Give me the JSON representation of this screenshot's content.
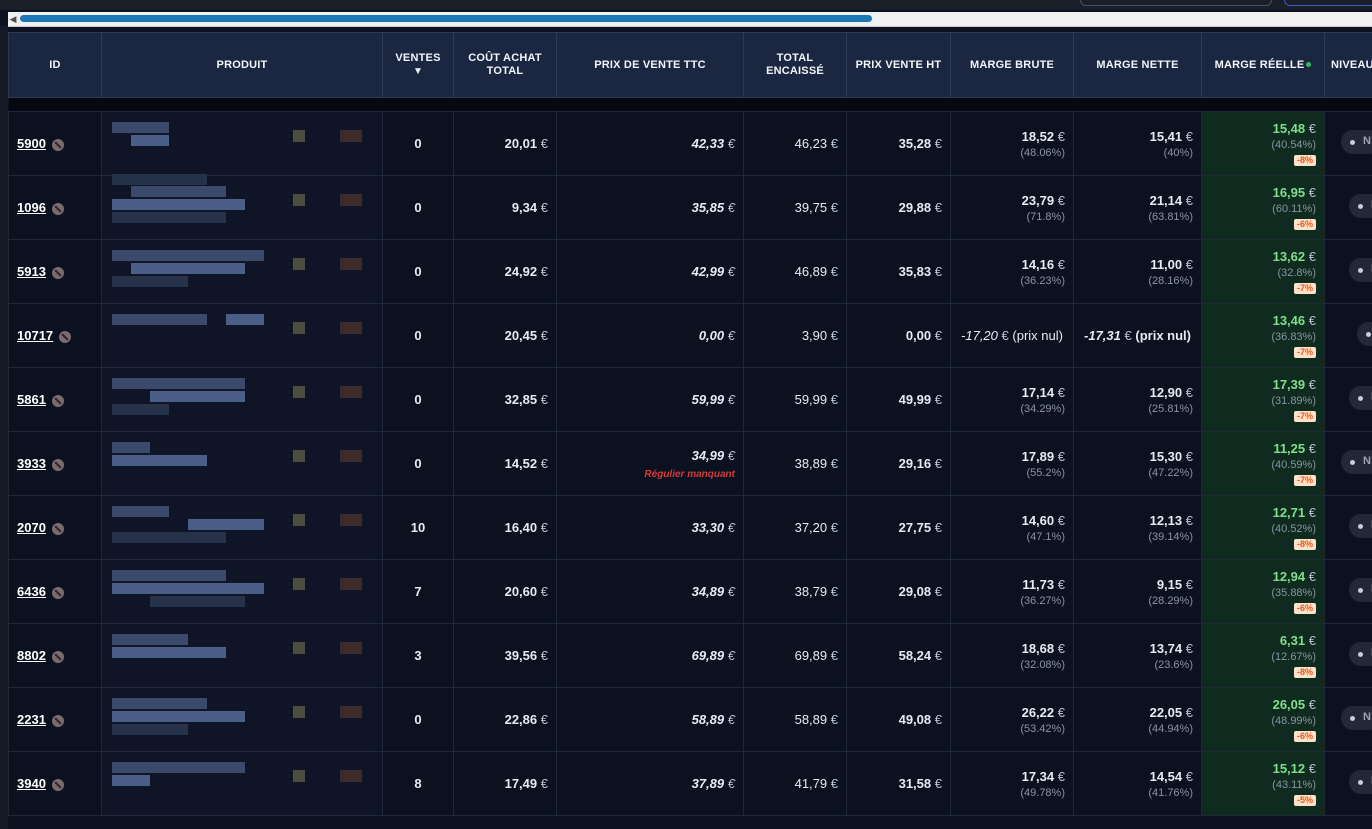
{
  "columns": {
    "id": "ID",
    "produit": "PRODUIT",
    "ventes": "VENTES",
    "ventes_sort": "▼",
    "cout": "COÛT ACHAT TOTAL",
    "ttc": "PRIX DE VENTE TTC",
    "encaisse": "TOTAL ENCAISSÉ",
    "ht": "PRIX VENTE HT",
    "marge_brute": "MARGE BRUTE",
    "marge_nette": "MARGE NETTE",
    "marge_reelle": "MARGE RÉELLE",
    "niveau": "NIVEAU"
  },
  "currency": "€",
  "rows": [
    {
      "id": "5900",
      "ventes": "0",
      "cout": "20,01",
      "ttc": "42,33",
      "encaisse": "46,23",
      "ht": "35,28",
      "mb": "18,52",
      "mb_pct": "(48.06%)",
      "mn": "15,41",
      "mn_pct": "(40%)",
      "mr": "15,48",
      "mr_pct": "(40.54%)",
      "mr_badge": "-8%"
    },
    {
      "id": "1096",
      "ventes": "0",
      "cout": "9,34",
      "ttc": "35,85",
      "encaisse": "39,75",
      "ht": "29,88",
      "mb": "23,79",
      "mb_pct": "(71.8%)",
      "mn": "21,14",
      "mn_pct": "(63.81%)",
      "mr": "16,95",
      "mr_pct": "(60.11%)",
      "mr_badge": "-6%"
    },
    {
      "id": "5913",
      "ventes": "0",
      "cout": "24,92",
      "ttc": "42,99",
      "encaisse": "46,89",
      "ht": "35,83",
      "mb": "14,16",
      "mb_pct": "(36.23%)",
      "mn": "11,00",
      "mn_pct": "(28.16%)",
      "mr": "13,62",
      "mr_pct": "(32.8%)",
      "mr_badge": "-7%"
    },
    {
      "id": "10717",
      "ventes": "0",
      "cout": "20,45",
      "ttc": "0,00",
      "encaisse": "3,90",
      "ht": "0,00",
      "mb": "-17,20",
      "mb_note": "(prix nul)",
      "mn": "-17,31",
      "mn_note": "(prix nul)",
      "mr": "13,46",
      "mr_pct": "(36.83%)",
      "mr_badge": "-7%"
    },
    {
      "id": "5861",
      "ventes": "0",
      "cout": "32,85",
      "ttc": "59,99",
      "encaisse": "59,99",
      "ht": "49,99",
      "mb": "17,14",
      "mb_pct": "(34.29%)",
      "mn": "12,90",
      "mn_pct": "(25.81%)",
      "mr": "17,39",
      "mr_pct": "(31.89%)",
      "mr_badge": "-7%"
    },
    {
      "id": "3933",
      "ventes": "0",
      "cout": "14,52",
      "ttc": "34,99",
      "ttc_warn": "Régulier manquant",
      "encaisse": "38,89",
      "ht": "29,16",
      "mb": "17,89",
      "mb_pct": "(55.2%)",
      "mn": "15,30",
      "mn_pct": "(47.22%)",
      "mr": "11,25",
      "mr_pct": "(40.59%)",
      "mr_badge": "-7%"
    },
    {
      "id": "2070",
      "ventes": "10",
      "cout": "16,40",
      "ttc": "33,30",
      "encaisse": "37,20",
      "ht": "27,75",
      "mb": "14,60",
      "mb_pct": "(47.1%)",
      "mn": "12,13",
      "mn_pct": "(39.14%)",
      "mr": "12,71",
      "mr_pct": "(40.52%)",
      "mr_badge": "-8%"
    },
    {
      "id": "6436",
      "ventes": "7",
      "cout": "20,60",
      "ttc": "34,89",
      "encaisse": "38,79",
      "ht": "29,08",
      "mb": "11,73",
      "mb_pct": "(36.27%)",
      "mn": "9,15",
      "mn_pct": "(28.29%)",
      "mr": "12,94",
      "mr_pct": "(35.88%)",
      "mr_badge": "-6%"
    },
    {
      "id": "8802",
      "ventes": "3",
      "cout": "39,56",
      "ttc": "69,89",
      "encaisse": "69,89",
      "ht": "58,24",
      "mb": "18,68",
      "mb_pct": "(32.08%)",
      "mn": "13,74",
      "mn_pct": "(23.6%)",
      "mr": "6,31",
      "mr_pct": "(12.67%)",
      "mr_badge": "-8%"
    },
    {
      "id": "2231",
      "ventes": "0",
      "cout": "22,86",
      "ttc": "58,89",
      "encaisse": "58,89",
      "ht": "49,08",
      "mb": "26,22",
      "mb_pct": "(53.42%)",
      "mn": "22,05",
      "mn_pct": "(44.94%)",
      "mr": "26,05",
      "mr_pct": "(48.99%)",
      "mr_badge": "-6%"
    },
    {
      "id": "3940",
      "ventes": "8",
      "cout": "17,49",
      "ttc": "37,89",
      "encaisse": "41,79",
      "ht": "31,58",
      "mb": "17,34",
      "mb_pct": "(49.78%)",
      "mn": "14,54",
      "mn_pct": "(41.76%)",
      "mr": "15,12",
      "mr_pct": "(43.11%)",
      "mr_badge": "-5%"
    }
  ]
}
